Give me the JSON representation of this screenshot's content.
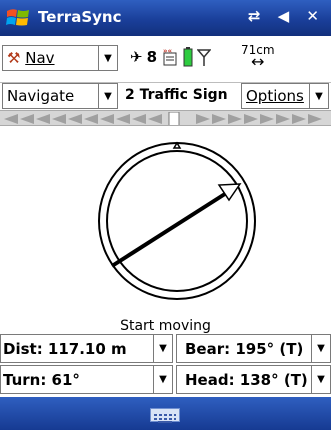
{
  "window": {
    "title": "TerraSync",
    "status_icons": "⇄ ◀ ✕"
  },
  "toolbar": {
    "section_label": "Nav",
    "satellite_count": "8",
    "antenna_height": "71cm",
    "antenna_arrow": "↔"
  },
  "nav": {
    "mode_label": "Navigate",
    "target": "2 Traffic Sign",
    "options_label": "Options"
  },
  "compass": {
    "status": "Start moving",
    "bearing_needle_deg": 57
  },
  "fields": {
    "dist": "Dist: 117.10 m",
    "bear": "Bear: 195° (T)",
    "turn": "Turn: 61°",
    "head": "Head: 138° (T)"
  },
  "colors": {
    "titlebar": "#1a3f9a",
    "steer_arrow": "#a0a0a0"
  },
  "icons": [
    "windows-logo-icon",
    "connection-icon",
    "speaker-icon",
    "close-icon",
    "pickaxe-icon",
    "satellite-icon",
    "gnss-receiver-icon",
    "battery-icon",
    "antenna-icon",
    "keyboard-icon"
  ]
}
